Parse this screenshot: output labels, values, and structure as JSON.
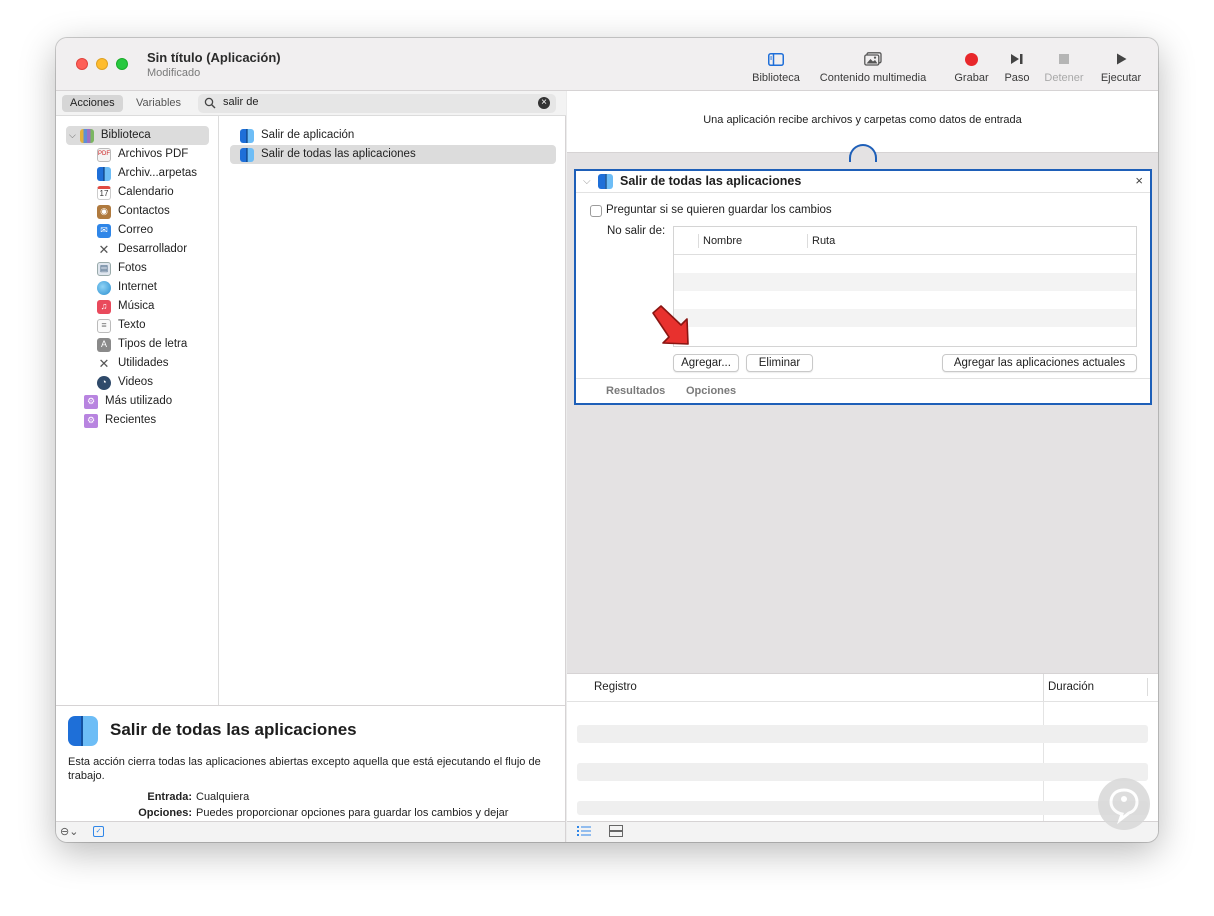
{
  "window": {
    "title": "Sin título (Aplicación)",
    "subtitle": "Modificado"
  },
  "toolbar": {
    "library": "Biblioteca",
    "media": "Contenido multimedia",
    "record": "Grabar",
    "step": "Paso",
    "stop": "Detener",
    "run": "Ejecutar"
  },
  "library": {
    "tabs": {
      "actions": "Acciones",
      "variables": "Variables"
    },
    "search": {
      "value": "salir de"
    },
    "tree": [
      {
        "label": "Biblioteca",
        "icon": "library-icon"
      },
      {
        "label": "Archivos PDF",
        "icon": "pdf-icon"
      },
      {
        "label": "Archiv...arpetas",
        "icon": "finder-icon"
      },
      {
        "label": "Calendario",
        "icon": "calendar-icon"
      },
      {
        "label": "Contactos",
        "icon": "contacts-icon"
      },
      {
        "label": "Correo",
        "icon": "mail-icon"
      },
      {
        "label": "Desarrollador",
        "icon": "developer-icon"
      },
      {
        "label": "Fotos",
        "icon": "photos-icon"
      },
      {
        "label": "Internet",
        "icon": "internet-icon"
      },
      {
        "label": "Música",
        "icon": "music-icon"
      },
      {
        "label": "Texto",
        "icon": "text-icon"
      },
      {
        "label": "Tipos de letra",
        "icon": "fonts-icon"
      },
      {
        "label": "Utilidades",
        "icon": "utilities-icon"
      },
      {
        "label": "Videos",
        "icon": "videos-icon"
      },
      {
        "label": "Más utilizado",
        "icon": "smart-folder-icon"
      },
      {
        "label": "Recientes",
        "icon": "smart-folder-icon"
      }
    ],
    "actions": [
      {
        "label": "Salir de aplicación"
      },
      {
        "label": "Salir de todas las aplicaciones"
      }
    ]
  },
  "description": {
    "title": "Salir de todas las aplicaciones",
    "text": "Esta acción cierra todas las aplicaciones abiertas excepto aquella que está ejecutando el flujo de trabajo.",
    "input_label": "Entrada:",
    "input_value": "Cualquiera",
    "options_label": "Opciones:",
    "options_value": "Puedes proporcionar opciones para guardar los cambios y dejar"
  },
  "workflow": {
    "info": "Una aplicación recibe archivos y carpetas como datos de entrada",
    "action": {
      "title": "Salir de todas las aplicaciones",
      "checkbox_label": "Preguntar si se quieren guardar los cambios",
      "no_quit_label": "No salir de:",
      "columns": [
        "Nombre",
        "Ruta"
      ],
      "add_button": "Agregar...",
      "remove_button": "Eliminar",
      "add_current_button": "Agregar las aplicaciones actuales",
      "footer_tabs": [
        "Resultados",
        "Opciones"
      ]
    }
  },
  "log": {
    "col_log": "Registro",
    "col_duration": "Duración"
  },
  "colors": {
    "accent": "#1e5fb8",
    "record": "#e8272b",
    "arrow": "#e8312e"
  }
}
